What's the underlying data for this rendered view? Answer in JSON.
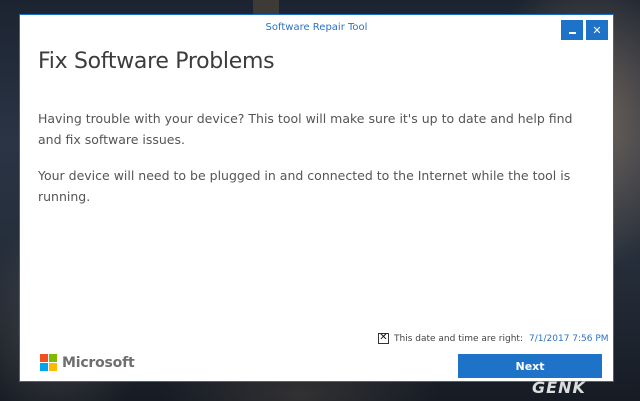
{
  "window": {
    "title": "Software Repair Tool",
    "minimize_icon": "minimize-icon",
    "close_icon": "close-icon",
    "close_glyph": "✕"
  },
  "content": {
    "heading": "Fix Software Problems",
    "paragraph1": "Having trouble with your device? This tool will make sure it's up to date and help find and fix software issues.",
    "paragraph2": "Your device will need to be plugged in and connected to the Internet while the tool is running."
  },
  "footer": {
    "logo_text": "Microsoft",
    "logo_icon": "microsoft-logo-icon",
    "datetime_checkbox": {
      "checked": true,
      "glyph": "✕",
      "label": "This date and time are right:",
      "value": "7/1/2017 7:56 PM"
    },
    "next_label": "Next"
  },
  "watermark": {
    "text": "GENK"
  },
  "colors": {
    "accent": "#1e73c8",
    "title_text": "#2b73c6",
    "ms_red": "#f25022",
    "ms_green": "#7fba00",
    "ms_blue": "#00a4ef",
    "ms_yellow": "#ffb900"
  }
}
